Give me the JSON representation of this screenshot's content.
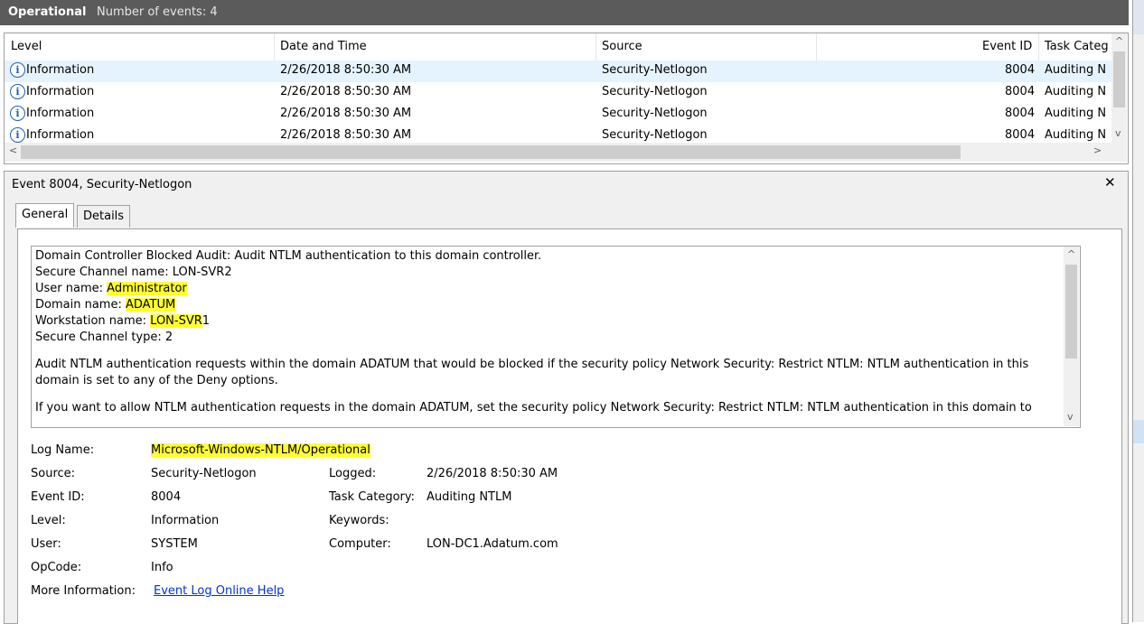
{
  "header": {
    "title": "Operational",
    "count": "Number of events: 4"
  },
  "columns": {
    "level": "Level",
    "datetime": "Date and Time",
    "source": "Source",
    "eventid": "Event ID",
    "task": "Task Categ"
  },
  "events": [
    {
      "level": "Information",
      "datetime": "2/26/2018 8:50:30 AM",
      "source": "Security-Netlogon",
      "eventid": "8004",
      "task": "Auditing N"
    },
    {
      "level": "Information",
      "datetime": "2/26/2018 8:50:30 AM",
      "source": "Security-Netlogon",
      "eventid": "8004",
      "task": "Auditing N"
    },
    {
      "level": "Information",
      "datetime": "2/26/2018 8:50:30 AM",
      "source": "Security-Netlogon",
      "eventid": "8004",
      "task": "Auditing N"
    },
    {
      "level": "Information",
      "datetime": "2/26/2018 8:50:30 AM",
      "source": "Security-Netlogon",
      "eventid": "8004",
      "task": "Auditing N"
    }
  ],
  "detail": {
    "title": "Event 8004, Security-Netlogon",
    "close": "✕",
    "tabs": {
      "general": "General",
      "details": "Details"
    },
    "description": {
      "line1": "Domain Controller Blocked Audit: Audit NTLM authentication to this domain controller.",
      "line2": "Secure Channel name: LON-SVR2",
      "user_label": "User name: ",
      "user_value": "Administrator",
      "domain_label": "Domain name: ",
      "domain_value": "ADATUM",
      "ws_label": "Workstation name: ",
      "ws_value": "LON-SVR",
      "ws_suffix": "1",
      "line6": "Secure Channel type: 2",
      "para1": "Audit NTLM authentication requests within the domain ADATUM that would be blocked if the security policy Network Security: Restrict NTLM: NTLM authentication in this domain is set to any of the Deny options.",
      "para2": "If you want to allow NTLM authentication requests in the domain ADATUM, set the security policy Network Security: Restrict NTLM: NTLM authentication in this domain to"
    },
    "fields": {
      "log_name_label": "Log Name:",
      "log_name": "Microsoft-Windows-NTLM/Operational",
      "source_label": "Source:",
      "source": "Security-Netlogon",
      "logged_label": "Logged:",
      "logged": "2/26/2018 8:50:30 AM",
      "eventid_label": "Event ID:",
      "eventid": "8004",
      "taskcat_label": "Task Category:",
      "taskcat": "Auditing NTLM",
      "level_label": "Level:",
      "level": "Information",
      "keywords_label": "Keywords:",
      "keywords": "",
      "user_label": "User:",
      "user": "SYSTEM",
      "computer_label": "Computer:",
      "computer": "LON-DC1.Adatum.com",
      "opcode_label": "OpCode:",
      "opcode": "Info",
      "moreinfo_label": "More Information:",
      "moreinfo_link": "Event Log Online Help"
    }
  },
  "colors": {
    "header_bg": "#5b5b5b",
    "highlight": "#ffff33",
    "link": "#0033cc",
    "selected_row": "#e5f3ff"
  }
}
